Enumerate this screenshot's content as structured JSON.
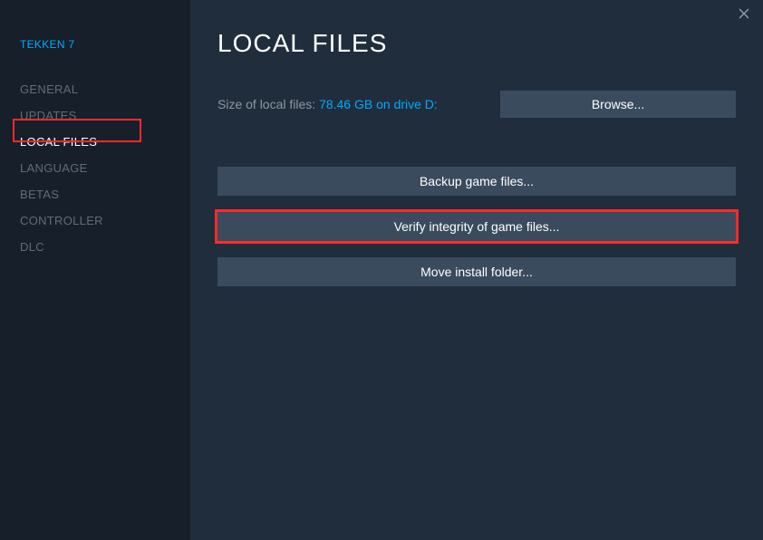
{
  "game_title": "TEKKEN 7",
  "sidebar": {
    "items": [
      {
        "label": "GENERAL"
      },
      {
        "label": "UPDATES"
      },
      {
        "label": "LOCAL FILES"
      },
      {
        "label": "LANGUAGE"
      },
      {
        "label": "BETAS"
      },
      {
        "label": "CONTROLLER"
      },
      {
        "label": "DLC"
      }
    ]
  },
  "main": {
    "title": "LOCAL FILES",
    "size_label": "Size of local files: ",
    "size_value": "78.46 GB on drive D:",
    "browse_label": "Browse...",
    "backup_label": "Backup game files...",
    "verify_label": "Verify integrity of game files...",
    "move_label": "Move install folder..."
  }
}
